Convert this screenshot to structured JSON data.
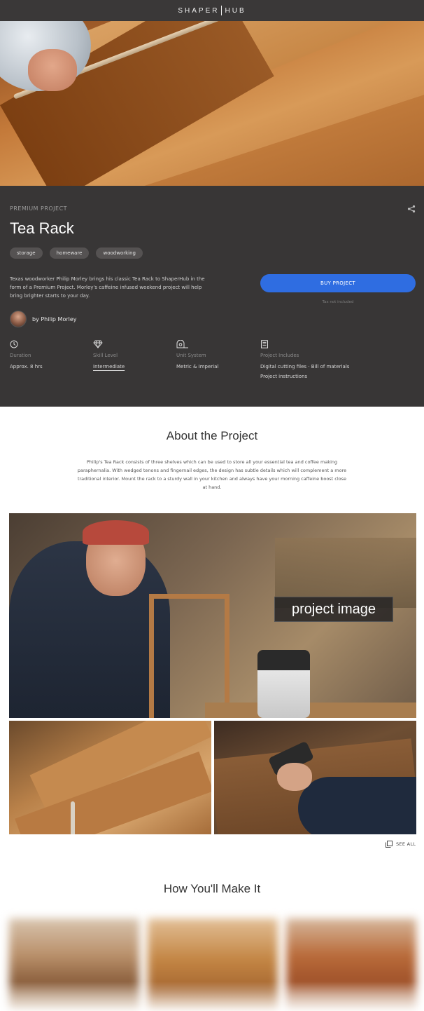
{
  "header": {
    "logo_left": "SHAPER",
    "logo_right": "HUB"
  },
  "hero": {
    "image_icon": "hero-woodworking-image"
  },
  "project": {
    "kicker": "PREMIUM PROJECT",
    "title": "Tea Rack",
    "tags": [
      "storage",
      "homeware",
      "woodworking"
    ],
    "description": "Texas woodworker Philip Morley brings his classic Tea Rack to ShaperHub in the form of a Premium Project. Morley's caffeine infused weekend project will help bring brighter starts to your day.",
    "author": "by Philip Morley",
    "buy_label": "BUY PROJECT",
    "tax_note": "Tax not included",
    "buy_color": "#2f6de1"
  },
  "specs": {
    "duration": {
      "label": "Duration",
      "value": "Approx. 8 hrs",
      "icon": "clock-icon"
    },
    "skill": {
      "label": "Skill Level",
      "value": "Intermediate",
      "icon": "diamond-icon"
    },
    "units": {
      "label": "Unit System",
      "value": "Metric & Imperial",
      "icon": "tape-measure-icon"
    },
    "includes": {
      "label": "Project Includes",
      "value_line1": "Digital cutting files · Bill of materials",
      "value_line2": "Project instructions",
      "icon": "document-icon"
    }
  },
  "about": {
    "heading": "About the Project",
    "text": "Philip's Tea Rack consists of three shelves which can be used to store all your essential tea and coffee making paraphernalia. With wedged tenons and fingernail edges, the design has subtle details which will complement a more traditional interior. Mount the rack to a sturdy wall in your kitchen and always have your morning caffeine boost close at hand."
  },
  "gallery": {
    "overlay_label": "project image",
    "see_all": "SEE ALL"
  },
  "how": {
    "heading": "How You'll Make It"
  }
}
